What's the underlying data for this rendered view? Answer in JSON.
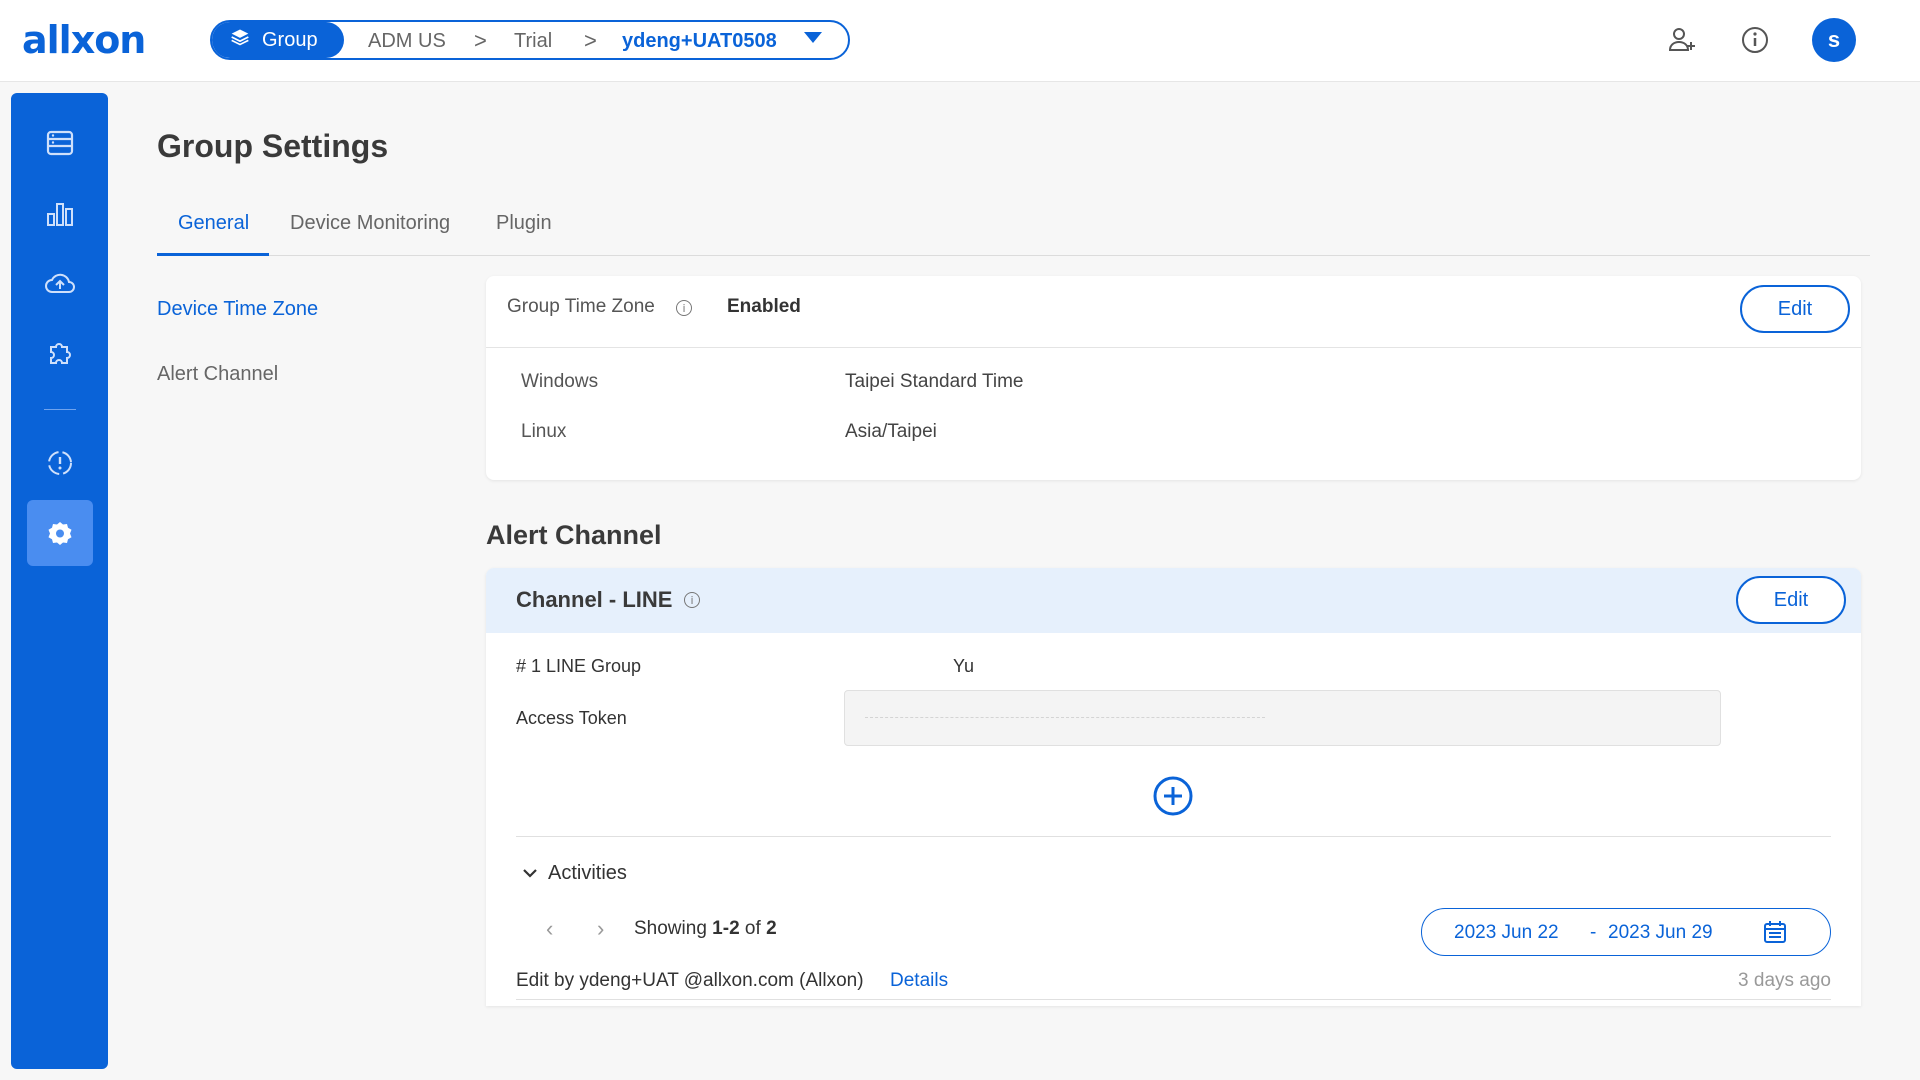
{
  "brand": {
    "logo_text": "allxon",
    "accent": "#0a63d8"
  },
  "breadcrumb": {
    "group_label": "Group",
    "items": [
      "ADM US",
      "Trial"
    ],
    "current": "ydeng+UAT0508",
    "separator": ">"
  },
  "topbar": {
    "icons": [
      "add-user-icon",
      "info-icon"
    ],
    "avatar_letter": "s"
  },
  "sidebar": {
    "items": [
      "devices-icon",
      "dashboard-icon",
      "ota-icon",
      "plugins-icon",
      "alert-icon",
      "settings-icon"
    ],
    "active": "settings-icon"
  },
  "page": {
    "title": "Group Settings",
    "tabs": [
      {
        "label": "General",
        "active": true
      },
      {
        "label": "Device Monitoring",
        "active": false
      },
      {
        "label": "Plugin",
        "active": false
      }
    ]
  },
  "leftnav": [
    {
      "label": "Device Time Zone",
      "active": true
    },
    {
      "label": "Alert Channel",
      "active": false
    }
  ],
  "timezone": {
    "label": "Group Time Zone",
    "status": "Enabled",
    "edit_label": "Edit",
    "rows": [
      {
        "os": "Windows",
        "value": "Taipei Standard Time"
      },
      {
        "os": "Linux",
        "value": "Asia/Taipei"
      }
    ]
  },
  "alert_channel": {
    "section_title": "Alert Channel",
    "channel_title": "Channel - LINE",
    "edit_label": "Edit",
    "group_label": "# 1 LINE Group",
    "group_value": "Yu",
    "token_label": "Access Token",
    "activities_label": "Activities",
    "showing_prefix": "Showing",
    "showing_range": "1-2",
    "showing_of": "of",
    "showing_total": "2",
    "date_from": "2023 Jun 22",
    "date_sep": "-",
    "date_to": "2023 Jun 29",
    "activity_text": "Edit by ydeng+UAT @allxon.com (Allxon)",
    "activity_link": "Details",
    "activity_time": "3 days ago"
  }
}
